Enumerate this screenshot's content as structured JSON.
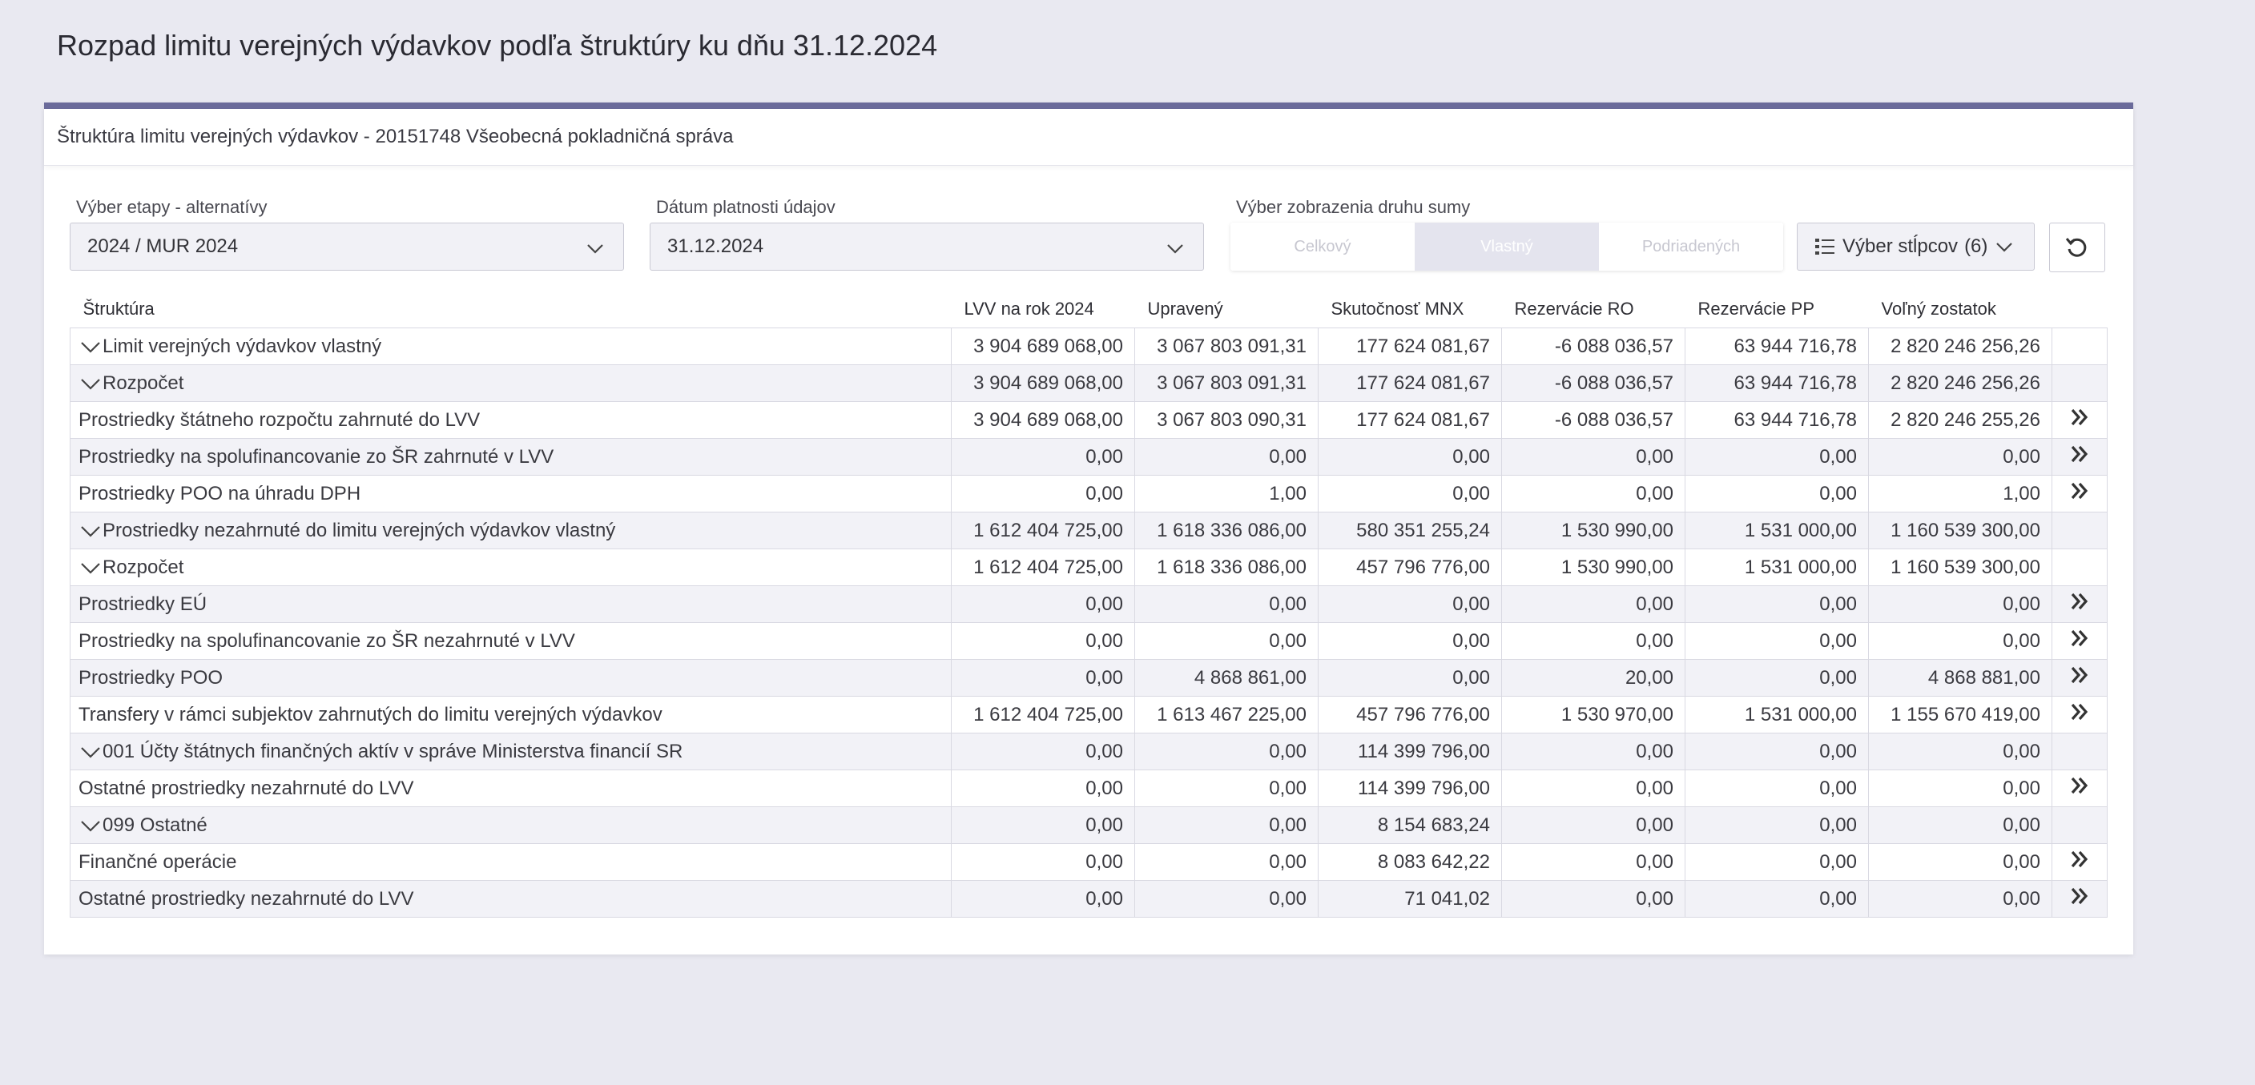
{
  "page_title": "Rozpad limitu verejných výdavkov podľa štruktúry ku dňu 31.12.2024",
  "card_title": "Štruktúra limitu verejných výdavkov - 20151748 Všeobecná pokladničná správa",
  "filters": {
    "stage_label": "Výber etapy - alternatívy",
    "stage_value": "2024 / MUR 2024",
    "date_label": "Dátum platnosti údajov",
    "date_value": "31.12.2024",
    "sum_label": "Výber zobrazenia druhu sumy",
    "sum_options": [
      "Celkový",
      "Vlastný",
      "Podriadených"
    ],
    "sum_selected": "Vlastný",
    "columns_button": "Výber stĺpcov",
    "columns_count": "(6)"
  },
  "table": {
    "headers": [
      "Štruktúra",
      "LVV na rok 2024",
      "Upravený",
      "Skutočnosť MNX",
      "Rezervácie RO",
      "Rezervácie PP",
      "Voľný zostatok"
    ],
    "rows": [
      {
        "name": "Limit verejných výdavkov vlastný",
        "values": [
          "3 904 689 068,00",
          "3 067 803 091,31",
          "177 624 081,67",
          "-6 088 036,57",
          "63 944 716,78",
          "2 820 246 256,26"
        ]
      },
      {
        "name": "Rozpočet",
        "values": [
          "3 904 689 068,00",
          "3 067 803 091,31",
          "177 624 081,67",
          "-6 088 036,57",
          "63 944 716,78",
          "2 820 246 256,26"
        ]
      },
      {
        "name": "Prostriedky štátneho rozpočtu zahrnuté do LVV",
        "values": [
          "3 904 689 068,00",
          "3 067 803 090,31",
          "177 624 081,67",
          "-6 088 036,57",
          "63 944 716,78",
          "2 820 246 255,26"
        ]
      },
      {
        "name": "Prostriedky na spolufinancovanie zo ŠR zahrnuté v LVV",
        "values": [
          "0,00",
          "0,00",
          "0,00",
          "0,00",
          "0,00",
          "0,00"
        ]
      },
      {
        "name": "Prostriedky POO na úhradu DPH",
        "values": [
          "0,00",
          "1,00",
          "0,00",
          "0,00",
          "0,00",
          "1,00"
        ]
      },
      {
        "name": "Prostriedky nezahrnuté do limitu verejných výdavkov vlastný",
        "values": [
          "1 612 404 725,00",
          "1 618 336 086,00",
          "580 351 255,24",
          "1 530 990,00",
          "1 531 000,00",
          "1 160 539 300,00"
        ]
      },
      {
        "name": "Rozpočet",
        "values": [
          "1 612 404 725,00",
          "1 618 336 086,00",
          "457 796 776,00",
          "1 530 990,00",
          "1 531 000,00",
          "1 160 539 300,00"
        ]
      },
      {
        "name": "Prostriedky EÚ",
        "values": [
          "0,00",
          "0,00",
          "0,00",
          "0,00",
          "0,00",
          "0,00"
        ]
      },
      {
        "name": "Prostriedky na spolufinancovanie zo ŠR nezahrnuté v LVV",
        "values": [
          "0,00",
          "0,00",
          "0,00",
          "0,00",
          "0,00",
          "0,00"
        ]
      },
      {
        "name": "Prostriedky POO",
        "values": [
          "0,00",
          "4 868 861,00",
          "0,00",
          "20,00",
          "0,00",
          "4 868 881,00"
        ]
      },
      {
        "name": "Transfery v rámci subjektov zahrnutých do limitu verejných výdavkov",
        "values": [
          "1 612 404 725,00",
          "1 613 467 225,00",
          "457 796 776,00",
          "1 530 970,00",
          "1 531 000,00",
          "1 155 670 419,00"
        ]
      },
      {
        "name": "001 Účty štátnych finančných aktív v správe Ministerstva financií SR",
        "values": [
          "0,00",
          "0,00",
          "114 399 796,00",
          "0,00",
          "0,00",
          "0,00"
        ]
      },
      {
        "name": "Ostatné prostriedky nezahrnuté do LVV",
        "values": [
          "0,00",
          "0,00",
          "114 399 796,00",
          "0,00",
          "0,00",
          "0,00"
        ]
      },
      {
        "name": "099 Ostatné",
        "values": [
          "0,00",
          "0,00",
          "8 154 683,24",
          "0,00",
          "0,00",
          "0,00"
        ]
      },
      {
        "name": "Finančné operácie",
        "values": [
          "0,00",
          "0,00",
          "8 083 642,22",
          "0,00",
          "0,00",
          "0,00"
        ]
      },
      {
        "name": "Ostatné prostriedky nezahrnuté do LVV",
        "values": [
          "0,00",
          "0,00",
          "71 041,02",
          "0,00",
          "0,00",
          "0,00"
        ]
      }
    ]
  }
}
